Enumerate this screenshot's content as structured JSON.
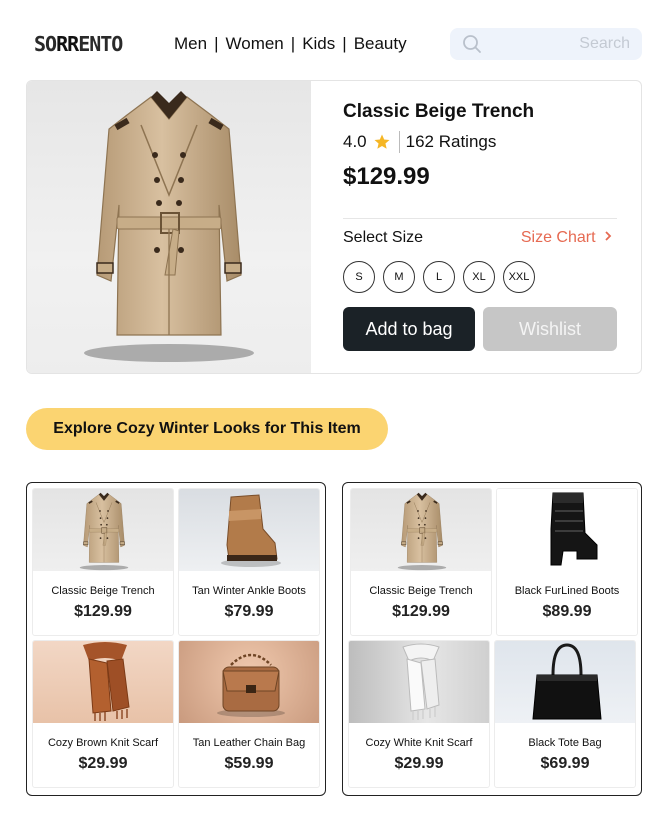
{
  "header": {
    "logo": {
      "pre": "SO",
      "mid": "RR",
      "post": "ENTO"
    },
    "nav": [
      "Men",
      "Women",
      "Kids",
      "Beauty"
    ],
    "search_placeholder": "Search"
  },
  "product": {
    "title": "Classic Beige Trench",
    "rating": "4.0",
    "ratings_count": "162 Ratings",
    "price": "$129.99",
    "size_label": "Select Size",
    "size_chart": "Size Chart",
    "sizes": [
      "S",
      "M",
      "L",
      "XL",
      "XXL"
    ],
    "add_to_bag": "Add to bag",
    "wishlist": "Wishlist"
  },
  "explore_label": "Explore Cozy Winter Looks for This Item",
  "outfits": [
    {
      "items": [
        {
          "name": "Classic Beige Trench",
          "price": "$129.99"
        },
        {
          "name": "Tan Winter Ankle Boots",
          "price": "$79.99"
        },
        {
          "name": "Cozy Brown Knit Scarf",
          "price": "$29.99"
        },
        {
          "name": "Tan Leather Chain Bag",
          "price": "$59.99"
        }
      ]
    },
    {
      "items": [
        {
          "name": "Classic Beige Trench",
          "price": "$129.99"
        },
        {
          "name": "Black FurLined Boots",
          "price": "$89.99"
        },
        {
          "name": "Cozy White Knit Scarf",
          "price": "$29.99"
        },
        {
          "name": "Black Tote Bag",
          "price": "$69.99"
        }
      ]
    }
  ],
  "colors": {
    "accent": "#e66a52",
    "banner": "#fbd471",
    "primary_button": "#1b2227",
    "secondary_button": "#c6c6c6",
    "star": "#f5b625"
  },
  "icons": [
    "search-icon",
    "star-icon",
    "chevron-right-icon"
  ]
}
